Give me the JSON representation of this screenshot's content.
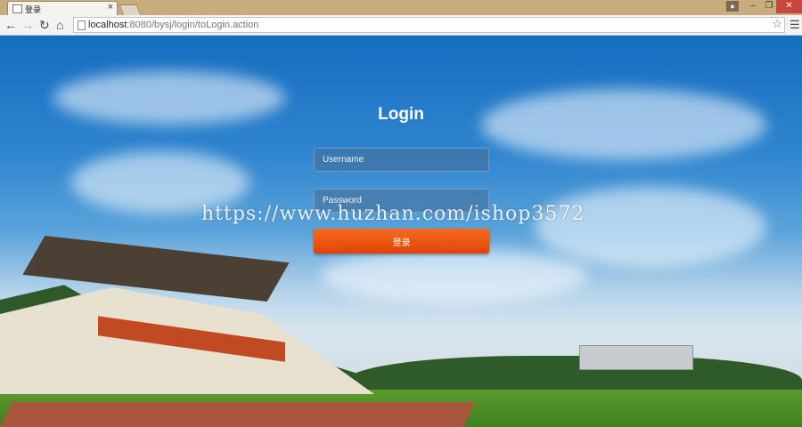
{
  "browser": {
    "tab_title": "登录",
    "tab_close": "×",
    "url_host": "localhost",
    "url_rest": ":8080/bysj/login/toLogin.action",
    "window_controls": {
      "minimize": "–",
      "maximize": "❐",
      "close": "✕"
    },
    "icons": {
      "back": "arrow-left-icon",
      "forward": "arrow-right-icon",
      "reload": "reload-icon",
      "home": "home-icon",
      "bookmark": "star-icon",
      "menu": "hamburger-menu-icon",
      "user": "user-icon"
    }
  },
  "login": {
    "title": "Login",
    "username_placeholder": "Username",
    "password_placeholder": "Password",
    "submit_label": "登录"
  },
  "watermark": "https://www.huzhan.com/ishop3572",
  "colors": {
    "button": "#ef5a14",
    "titlebar": "#c9ac7e",
    "sky": "#2f85cf"
  }
}
